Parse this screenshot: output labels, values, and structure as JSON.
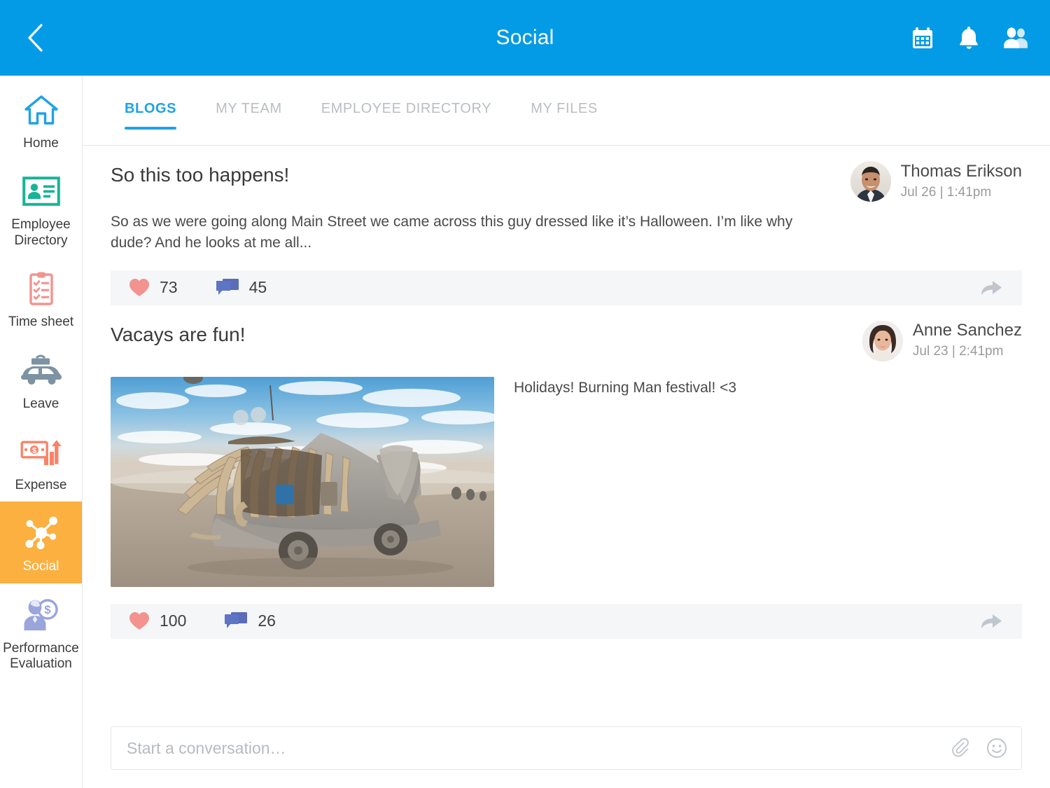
{
  "header": {
    "title": "Social",
    "back_icon": "chevron-left-icon",
    "actions": [
      {
        "icon": "calendar-icon",
        "name": "calendar"
      },
      {
        "icon": "bell-icon",
        "name": "notifications"
      },
      {
        "icon": "people-icon",
        "name": "contacts"
      }
    ]
  },
  "colors": {
    "header_blue": "#039BE5",
    "tab_active_blue": "#1FA2E8",
    "sidebar_active_orange": "#FBB040",
    "heart_pink": "#F2938F",
    "comment_blue": "#5B6CB8",
    "share_gray": "#BFC6CC",
    "engagement_bg": "#F4F6F8"
  },
  "sidebar": {
    "items": [
      {
        "label": "Home",
        "icon": "house-icon",
        "active": false,
        "color": "#1FA2E8"
      },
      {
        "label": "Employee Directory",
        "icon": "id-card-icon",
        "active": false,
        "color": "#17B497"
      },
      {
        "label": "Time sheet",
        "icon": "clipboard-checklist-icon",
        "active": false,
        "color": "#F2938F"
      },
      {
        "label": "Leave",
        "icon": "car-luggage-icon",
        "active": false,
        "color": "#7D93A3"
      },
      {
        "label": "Expense",
        "icon": "money-chart-icon",
        "active": false,
        "color": "#FA8367"
      },
      {
        "label": "Social",
        "icon": "network-nodes-icon",
        "active": true,
        "color": "#FFFFFF"
      },
      {
        "label": "Performance Evaluation",
        "icon": "person-dollar-icon",
        "active": false,
        "color": "#9AA5DC"
      }
    ]
  },
  "tabs": [
    {
      "label": "BLOGS",
      "active": true
    },
    {
      "label": "MY TEAM",
      "active": false
    },
    {
      "label": "EMPLOYEE DIRECTORY",
      "active": false
    },
    {
      "label": "MY FILES",
      "active": false
    }
  ],
  "posts": [
    {
      "title": "So this too happens!",
      "body": "So as we were going along Main Street we came across this guy dressed like it’s Halloween. I’m like why dude? And he looks at me all...",
      "author": "Thomas Erikson",
      "date": "Jul 26 | 1:41pm",
      "likes": "73",
      "comments": "45",
      "has_photo": false,
      "caption": ""
    },
    {
      "title": "Vacays are fun!",
      "body": "",
      "author": "Anne Sanchez",
      "date": "Jul 23 | 2:41pm",
      "likes": "100",
      "comments": "26",
      "has_photo": true,
      "caption": "Holidays! Burning Man festival! <3",
      "photo_alt": "Burning Man art car shaped like a fish on the desert playa"
    }
  ],
  "composer": {
    "placeholder": "Start a conversation…",
    "value": "",
    "attach_icon": "paperclip-icon",
    "emoji_icon": "smiley-icon"
  }
}
